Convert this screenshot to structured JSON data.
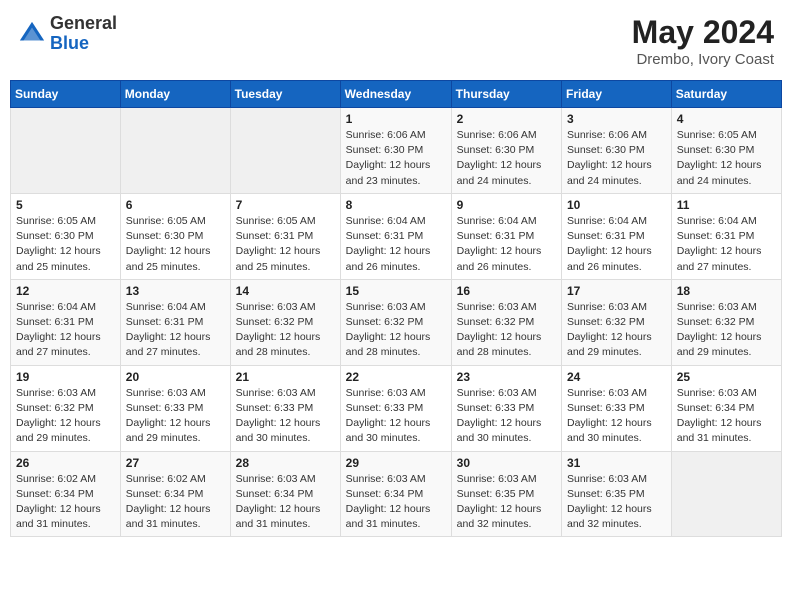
{
  "header": {
    "logo_general": "General",
    "logo_blue": "Blue",
    "title": "May 2024",
    "location": "Drembo, Ivory Coast"
  },
  "weekdays": [
    "Sunday",
    "Monday",
    "Tuesday",
    "Wednesday",
    "Thursday",
    "Friday",
    "Saturday"
  ],
  "weeks": [
    [
      {
        "day": "",
        "info": ""
      },
      {
        "day": "",
        "info": ""
      },
      {
        "day": "",
        "info": ""
      },
      {
        "day": "1",
        "info": "Sunrise: 6:06 AM\nSunset: 6:30 PM\nDaylight: 12 hours\nand 23 minutes."
      },
      {
        "day": "2",
        "info": "Sunrise: 6:06 AM\nSunset: 6:30 PM\nDaylight: 12 hours\nand 24 minutes."
      },
      {
        "day": "3",
        "info": "Sunrise: 6:06 AM\nSunset: 6:30 PM\nDaylight: 12 hours\nand 24 minutes."
      },
      {
        "day": "4",
        "info": "Sunrise: 6:05 AM\nSunset: 6:30 PM\nDaylight: 12 hours\nand 24 minutes."
      }
    ],
    [
      {
        "day": "5",
        "info": "Sunrise: 6:05 AM\nSunset: 6:30 PM\nDaylight: 12 hours\nand 25 minutes."
      },
      {
        "day": "6",
        "info": "Sunrise: 6:05 AM\nSunset: 6:30 PM\nDaylight: 12 hours\nand 25 minutes."
      },
      {
        "day": "7",
        "info": "Sunrise: 6:05 AM\nSunset: 6:31 PM\nDaylight: 12 hours\nand 25 minutes."
      },
      {
        "day": "8",
        "info": "Sunrise: 6:04 AM\nSunset: 6:31 PM\nDaylight: 12 hours\nand 26 minutes."
      },
      {
        "day": "9",
        "info": "Sunrise: 6:04 AM\nSunset: 6:31 PM\nDaylight: 12 hours\nand 26 minutes."
      },
      {
        "day": "10",
        "info": "Sunrise: 6:04 AM\nSunset: 6:31 PM\nDaylight: 12 hours\nand 26 minutes."
      },
      {
        "day": "11",
        "info": "Sunrise: 6:04 AM\nSunset: 6:31 PM\nDaylight: 12 hours\nand 27 minutes."
      }
    ],
    [
      {
        "day": "12",
        "info": "Sunrise: 6:04 AM\nSunset: 6:31 PM\nDaylight: 12 hours\nand 27 minutes."
      },
      {
        "day": "13",
        "info": "Sunrise: 6:04 AM\nSunset: 6:31 PM\nDaylight: 12 hours\nand 27 minutes."
      },
      {
        "day": "14",
        "info": "Sunrise: 6:03 AM\nSunset: 6:32 PM\nDaylight: 12 hours\nand 28 minutes."
      },
      {
        "day": "15",
        "info": "Sunrise: 6:03 AM\nSunset: 6:32 PM\nDaylight: 12 hours\nand 28 minutes."
      },
      {
        "day": "16",
        "info": "Sunrise: 6:03 AM\nSunset: 6:32 PM\nDaylight: 12 hours\nand 28 minutes."
      },
      {
        "day": "17",
        "info": "Sunrise: 6:03 AM\nSunset: 6:32 PM\nDaylight: 12 hours\nand 29 minutes."
      },
      {
        "day": "18",
        "info": "Sunrise: 6:03 AM\nSunset: 6:32 PM\nDaylight: 12 hours\nand 29 minutes."
      }
    ],
    [
      {
        "day": "19",
        "info": "Sunrise: 6:03 AM\nSunset: 6:32 PM\nDaylight: 12 hours\nand 29 minutes."
      },
      {
        "day": "20",
        "info": "Sunrise: 6:03 AM\nSunset: 6:33 PM\nDaylight: 12 hours\nand 29 minutes."
      },
      {
        "day": "21",
        "info": "Sunrise: 6:03 AM\nSunset: 6:33 PM\nDaylight: 12 hours\nand 30 minutes."
      },
      {
        "day": "22",
        "info": "Sunrise: 6:03 AM\nSunset: 6:33 PM\nDaylight: 12 hours\nand 30 minutes."
      },
      {
        "day": "23",
        "info": "Sunrise: 6:03 AM\nSunset: 6:33 PM\nDaylight: 12 hours\nand 30 minutes."
      },
      {
        "day": "24",
        "info": "Sunrise: 6:03 AM\nSunset: 6:33 PM\nDaylight: 12 hours\nand 30 minutes."
      },
      {
        "day": "25",
        "info": "Sunrise: 6:03 AM\nSunset: 6:34 PM\nDaylight: 12 hours\nand 31 minutes."
      }
    ],
    [
      {
        "day": "26",
        "info": "Sunrise: 6:02 AM\nSunset: 6:34 PM\nDaylight: 12 hours\nand 31 minutes."
      },
      {
        "day": "27",
        "info": "Sunrise: 6:02 AM\nSunset: 6:34 PM\nDaylight: 12 hours\nand 31 minutes."
      },
      {
        "day": "28",
        "info": "Sunrise: 6:03 AM\nSunset: 6:34 PM\nDaylight: 12 hours\nand 31 minutes."
      },
      {
        "day": "29",
        "info": "Sunrise: 6:03 AM\nSunset: 6:34 PM\nDaylight: 12 hours\nand 31 minutes."
      },
      {
        "day": "30",
        "info": "Sunrise: 6:03 AM\nSunset: 6:35 PM\nDaylight: 12 hours\nand 32 minutes."
      },
      {
        "day": "31",
        "info": "Sunrise: 6:03 AM\nSunset: 6:35 PM\nDaylight: 12 hours\nand 32 minutes."
      },
      {
        "day": "",
        "info": ""
      }
    ]
  ]
}
